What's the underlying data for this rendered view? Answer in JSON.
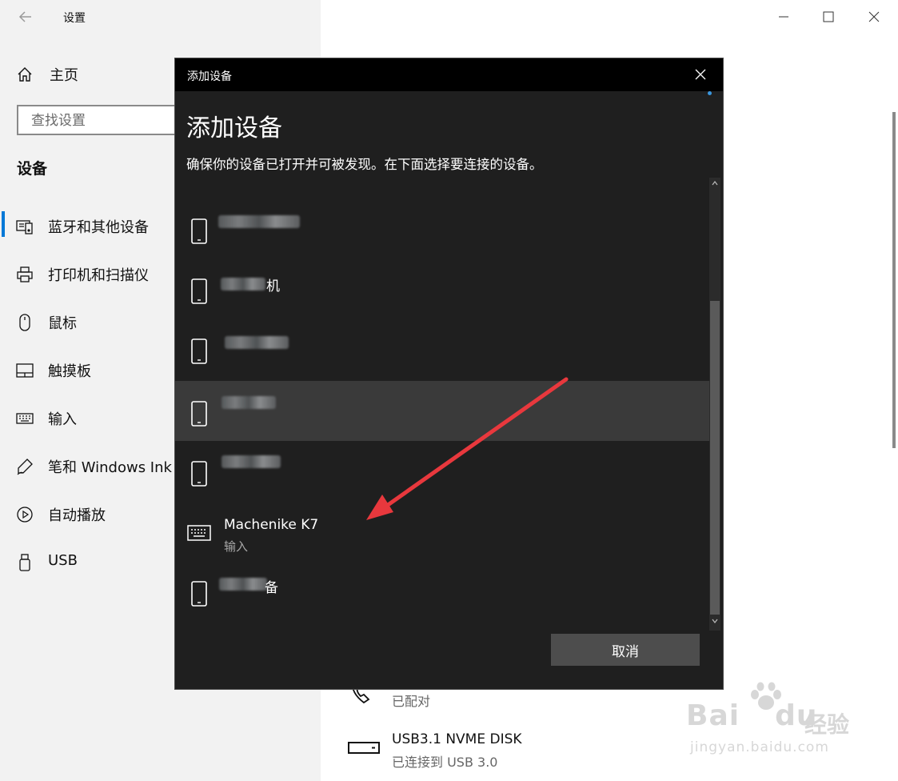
{
  "app": {
    "title": "设置",
    "home_label": "主页",
    "search_placeholder": "查找设置",
    "section_title": "设备"
  },
  "nav": {
    "items": [
      {
        "label": "蓝牙和其他设备",
        "icon": "bluetooth-devices-icon",
        "active": true
      },
      {
        "label": "打印机和扫描仪",
        "icon": "printer-icon"
      },
      {
        "label": "鼠标",
        "icon": "mouse-icon"
      },
      {
        "label": "触摸板",
        "icon": "touchpad-icon"
      },
      {
        "label": "输入",
        "icon": "keyboard-icon"
      },
      {
        "label": "笔和 Windows Ink",
        "icon": "pen-icon"
      },
      {
        "label": "自动播放",
        "icon": "autoplay-icon"
      },
      {
        "label": "USB",
        "icon": "usb-icon"
      }
    ]
  },
  "background_devices": [
    {
      "name": "",
      "status": "已配对",
      "icon": "phone-call-icon"
    },
    {
      "name": "USB3.1 NVME DISK",
      "status": "已连接到 USB 3.0",
      "icon": "disk-icon"
    }
  ],
  "dialog": {
    "titlebar": "添加设备",
    "heading": "添加设备",
    "description": "确保你的设备已打开并可被发现。在下面选择要连接的设备。",
    "devices": [
      {
        "name": "",
        "icon": "phone-icon",
        "obscured": true
      },
      {
        "name": "机",
        "icon": "phone-icon",
        "obscured": true
      },
      {
        "name": "",
        "icon": "phone-icon",
        "obscured": true
      },
      {
        "name": "",
        "icon": "phone-icon",
        "obscured": true,
        "highlighted": true
      },
      {
        "name": "",
        "icon": "phone-icon",
        "obscured": true
      },
      {
        "name": "Machenike K7",
        "sub": "输入",
        "icon": "keyboard-icon"
      },
      {
        "name": "备",
        "icon": "phone-icon",
        "obscured": true
      }
    ],
    "cancel_label": "取消"
  },
  "watermark": {
    "brand": "Bai",
    "brand_suffix": "du",
    "product": "经验",
    "url": "jingyan.baidu.com"
  },
  "colors": {
    "accent": "#0078d7",
    "dialog_bg": "#1f1f1f",
    "annotation_arrow": "#e8383d"
  }
}
